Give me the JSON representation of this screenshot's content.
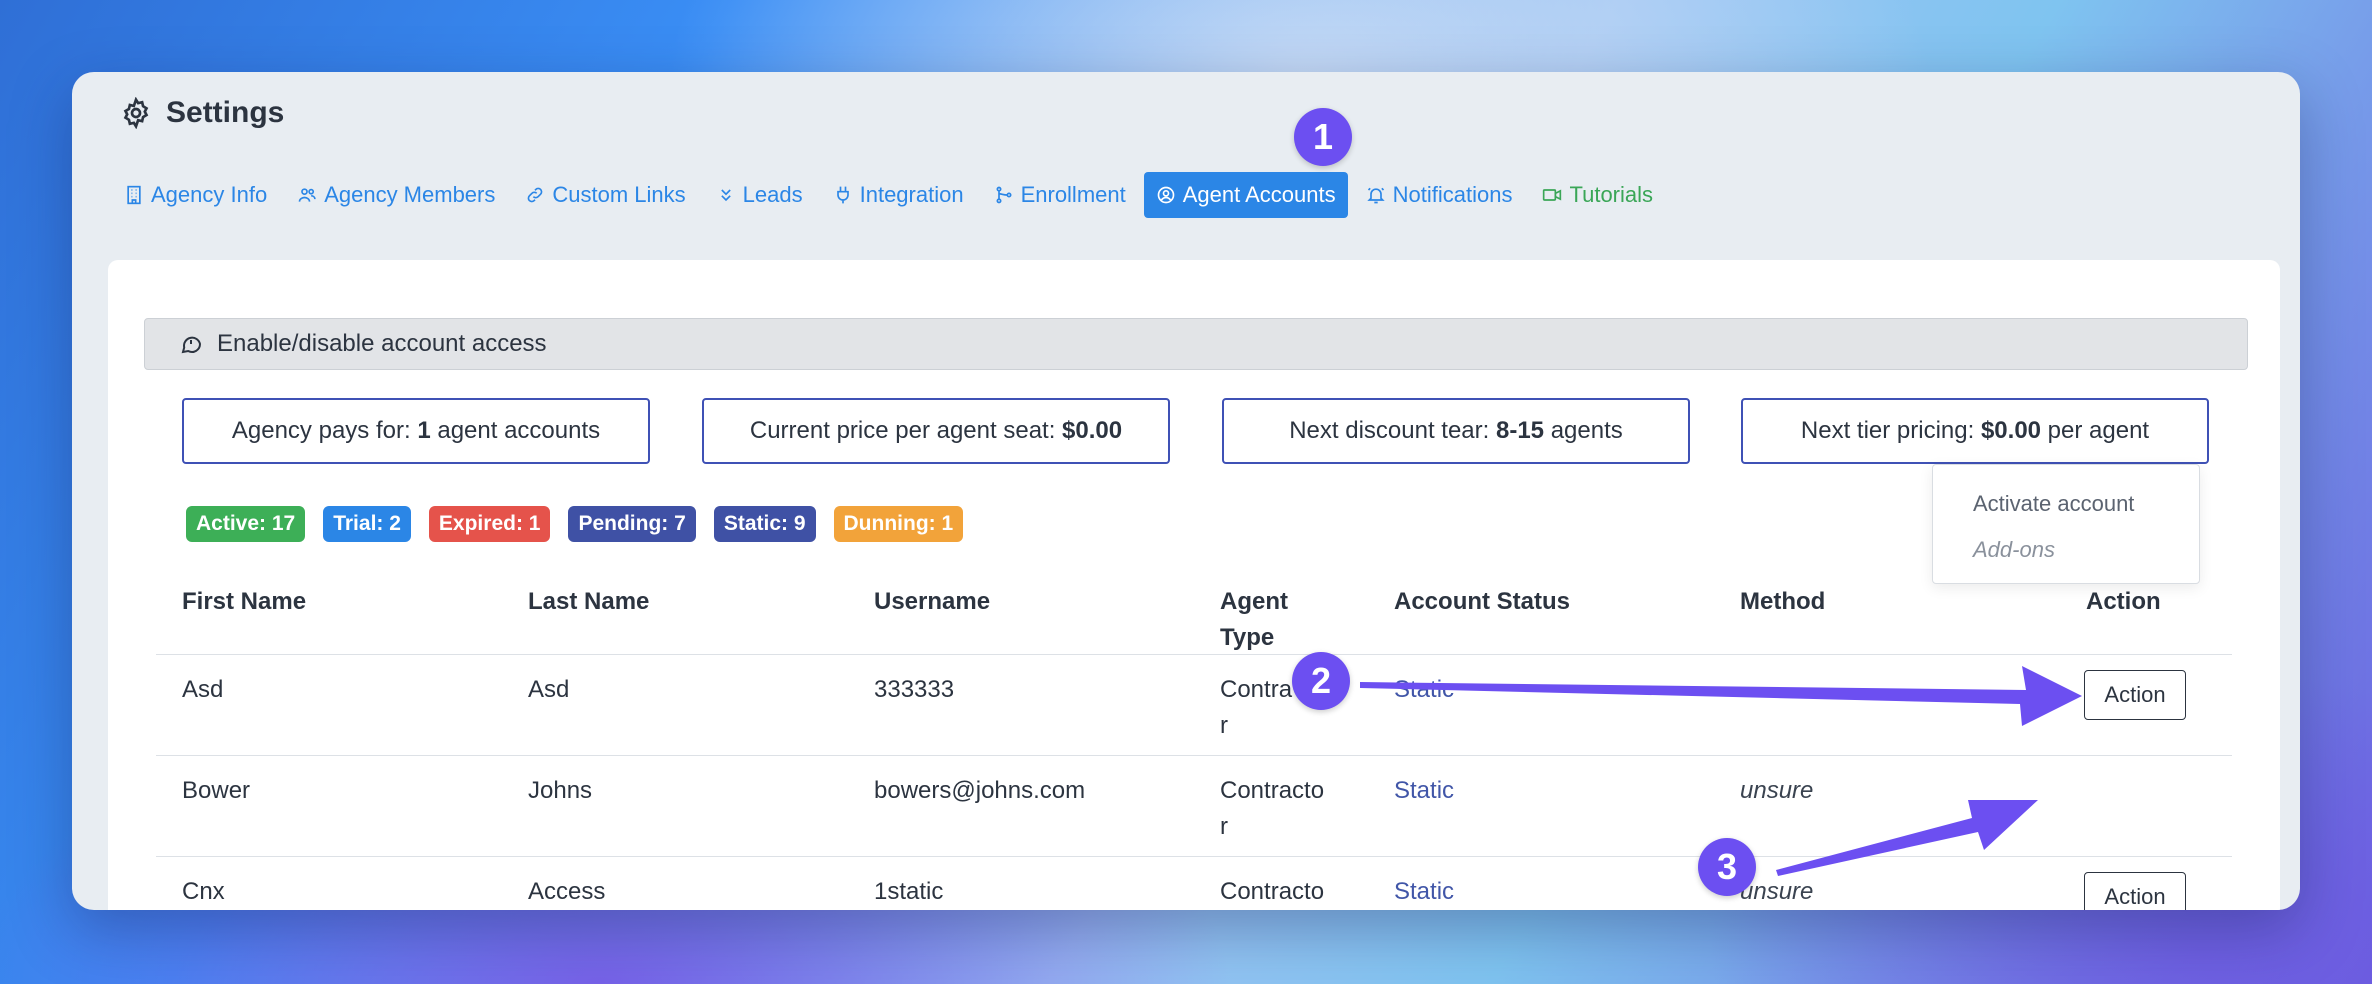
{
  "page": {
    "title": "Settings"
  },
  "tabs": [
    {
      "label": "Agency Info",
      "icon": "building-icon",
      "active": false
    },
    {
      "label": "Agency Members",
      "icon": "users-icon",
      "active": false
    },
    {
      "label": "Custom Links",
      "icon": "link-icon",
      "active": false
    },
    {
      "label": "Leads",
      "icon": "double-chevron-down-icon",
      "active": false
    },
    {
      "label": "Integration",
      "icon": "plug-icon",
      "active": false
    },
    {
      "label": "Enrollment",
      "icon": "git-branch-icon",
      "active": false
    },
    {
      "label": "Agent Accounts",
      "icon": "user-circle-icon",
      "active": true
    },
    {
      "label": "Notifications",
      "icon": "bell-icon",
      "active": false
    },
    {
      "label": "Tutorials",
      "icon": "video-icon",
      "active": false
    }
  ],
  "alert": {
    "text": "Enable/disable account access",
    "icon": "message-circle-icon"
  },
  "info_boxes": [
    {
      "prefix": "Agency pays for: ",
      "bold": "1",
      "suffix": " agent accounts"
    },
    {
      "prefix": "Current price per agent seat: ",
      "bold": "$0.00",
      "suffix": ""
    },
    {
      "prefix": "Next discount tear: ",
      "bold": "8-15",
      "suffix": " agents"
    },
    {
      "prefix": "Next tier pricing: ",
      "bold": "$0.00",
      "suffix": " per agent"
    }
  ],
  "badges": [
    {
      "label": "Active: 17",
      "color": "#3daf57"
    },
    {
      "label": "Trial: 2",
      "color": "#2b86e6"
    },
    {
      "label": "Expired: 1",
      "color": "#e5534b"
    },
    {
      "label": "Pending: 7",
      "color": "#3f51a5"
    },
    {
      "label": "Static: 9",
      "color": "#3f51a5"
    },
    {
      "label": "Dunning: 1",
      "color": "#f2a33a"
    }
  ],
  "table": {
    "headers": {
      "first_name": "First Name",
      "last_name": "Last Name",
      "username": "Username",
      "agent_type_1": "Agent",
      "agent_type_2": "Type",
      "account_status": "Account Status",
      "method": "Method",
      "action": "Action"
    },
    "rows": [
      {
        "first": "Asd",
        "last": "Asd",
        "username": "333333",
        "type1": "Contra",
        "type2": "r",
        "status": "Static",
        "method": "",
        "action": "Action"
      },
      {
        "first": "Bower",
        "last": "Johns",
        "username": "bowers@johns.com",
        "type1": "Contracto",
        "type2": "r",
        "status": "Static",
        "method": "unsure",
        "action": ""
      },
      {
        "first": "Cnx",
        "last": "Access",
        "username": "1static",
        "type1": "Contracto",
        "type2": "",
        "status": "Static",
        "method": "unsure",
        "action": "Action"
      }
    ]
  },
  "dropdown": {
    "items": [
      "Activate account",
      "Add-ons"
    ]
  },
  "markers": [
    "1",
    "2",
    "3"
  ],
  "colors": {
    "accent": "#2b86e6",
    "marker": "#6c4ff1",
    "box_border": "#3f51b5"
  }
}
